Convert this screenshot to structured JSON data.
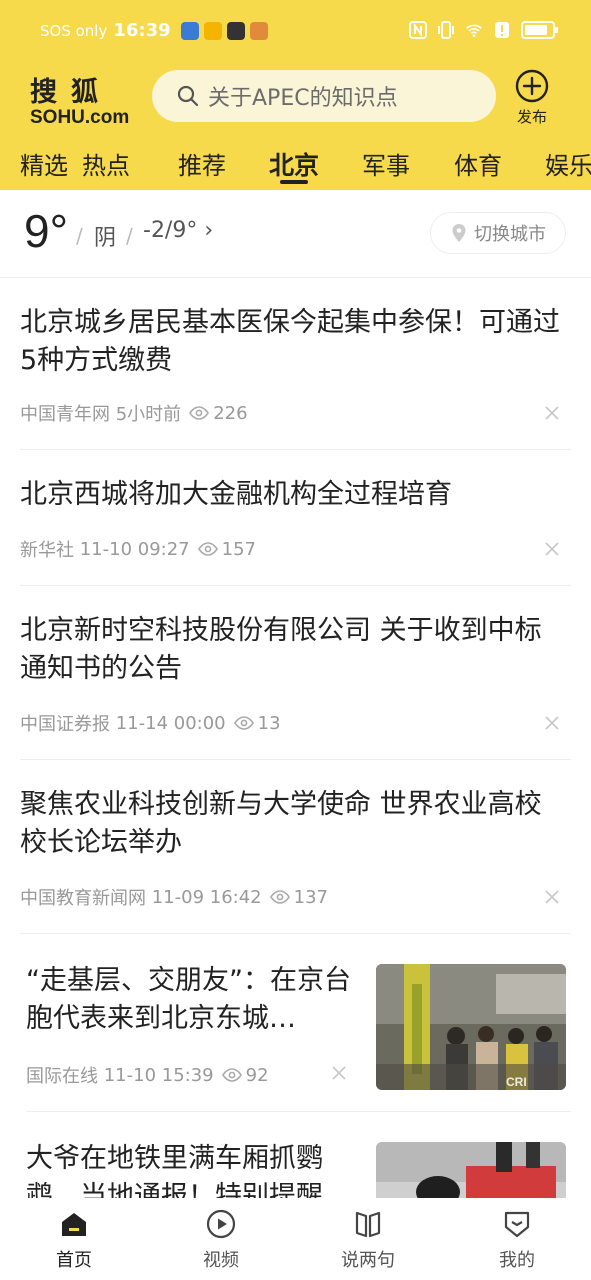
{
  "status_bar": {
    "network": "SOS only",
    "time": "16:39",
    "battery_level_percent": 85
  },
  "header": {
    "logo_cn": "搜狐",
    "logo_en": "SOHU.com",
    "search_placeholder": "关于APEC的知识点",
    "publish_label": "发布",
    "accent_color": "#f7d94c"
  },
  "tabs": [
    {
      "label": "精选",
      "active": false
    },
    {
      "label": "热点",
      "active": false
    },
    {
      "label": "推荐",
      "active": false
    },
    {
      "label": "北京",
      "active": true
    },
    {
      "label": "军事",
      "active": false
    },
    {
      "label": "体育",
      "active": false
    },
    {
      "label": "娱乐",
      "active": false
    }
  ],
  "weather": {
    "temperature": "9°",
    "condition": "阴",
    "range": "-2/9°",
    "switch_city_label": "切换城市"
  },
  "news": [
    {
      "title": "北京城乡居民基本医保今起集中参保！可通过5种方式缴费",
      "source": "中国青年网",
      "time": "5小时前",
      "views": "226"
    },
    {
      "title": "北京西城将加大金融机构全过程培育",
      "source": "新华社",
      "time": "11-10 09:27",
      "views": "157"
    },
    {
      "title": "北京新时空科技股份有限公司 关于收到中标通知书的公告",
      "source": "中国证券报",
      "time": "11-14 00:00",
      "views": "13"
    },
    {
      "title": "聚焦农业科技创新与大学使命 世界农业高校校长论坛举办",
      "source": "中国教育新闻网",
      "time": "11-09 16:42",
      "views": "137"
    },
    {
      "title": "“走基层、交朋友”：在京台胞代表来到北京东城…",
      "source": "国际在线",
      "time": "11-10 15:39",
      "views": "92",
      "image_watermark": "CRI"
    },
    {
      "title": "大爷在地铁里满车厢抓鹦鹉，当地通报！特别提醒",
      "source": "",
      "time": "",
      "views": ""
    }
  ],
  "bottom_nav": [
    {
      "label": "首页",
      "icon": "home-icon",
      "active": true
    },
    {
      "label": "视频",
      "icon": "play-icon",
      "active": false
    },
    {
      "label": "说两句",
      "icon": "book-icon",
      "active": false
    },
    {
      "label": "我的",
      "icon": "profile-shield-icon",
      "active": false
    }
  ]
}
